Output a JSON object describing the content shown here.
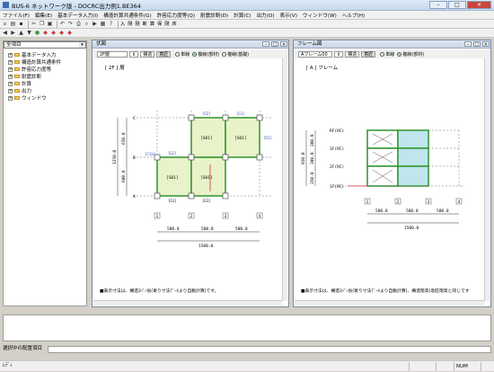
{
  "window": {
    "title": "BUS-6 ネットワーク版 - DOCRC出力例1.BE364",
    "btn_min": "–",
    "btn_max": "□",
    "btn_close": "✕"
  },
  "menu": [
    "ファイル(F)",
    "編集(E)",
    "基本データ入力(I)",
    "構造計算共通条件(G)",
    "許容応力度等(Q)",
    "耐震診断(D)",
    "計算(C)",
    "出力(O)",
    "表示(V)",
    "ウィンドウ(W)",
    "ヘルプ(H)"
  ],
  "toolbar2": [
    "入",
    "剛",
    "剛",
    "断",
    "算",
    "保",
    "剛",
    "床"
  ],
  "tree": {
    "select": "全項目",
    "items": [
      "基本データ入力",
      "構造計算共通条件",
      "許容応力度等",
      "耐震診断",
      "計算",
      "出力",
      "ウィンドウ"
    ]
  },
  "plan": {
    "caption": "伏図",
    "floor": "2F層",
    "tabs": [
      "構造",
      "意匠"
    ],
    "radio1": "単線",
    "radio2": "複線(部材)",
    "radio3": "複線(基礎)",
    "heading": "[ 2F ] 層",
    "note": "■表示寸法は、構造ｽﾊﾟﾝ長(寄り寸法ﾃﾞｰﾀより自動計算)です。",
    "axes_x": [
      "1",
      "2",
      "3",
      "4"
    ],
    "axes_y": [
      "A",
      "B",
      "C"
    ],
    "spans": [
      "500.0",
      "500.0",
      "500.0"
    ],
    "total": "1500.0",
    "yspans": [
      "600.0",
      "650.0"
    ],
    "ytotal": "1250.0",
    "slab": "[S01]",
    "beams": [
      "[G1]",
      "[G2]",
      "[G2]",
      "[G1]",
      "[C1a]",
      "[D1]"
    ]
  },
  "frame": {
    "caption": "フレーム図",
    "frame": "Aフレーム00",
    "tabs": [
      "構造",
      "意匠"
    ],
    "radio1": "単線",
    "radio2": "複線(部材)",
    "heading": "[ A ] フレーム",
    "note": "■表示寸法は、構造ｽﾊﾟﾝ長(寄り寸法ﾃﾞｰﾀより自動計算)、構造階高(意匠階高と同じです",
    "floors": [
      "RF(RC)",
      "3F(RC)",
      "2F(RC)",
      "1F(RC)"
    ],
    "axes_x": [
      "1",
      "2",
      "3",
      "4"
    ],
    "spans": [
      "500.0",
      "500.0",
      "500.0"
    ],
    "total": "1500.0",
    "heights": [
      "300.0",
      "300.0",
      "350.0"
    ],
    "htotal": "950.0"
  },
  "info": {
    "label": "選択中の配置項目"
  },
  "status": {
    "left": "ﾚﾃﾞｨ",
    "num": "NUM"
  },
  "colors": {
    "green": "#3a9a3a",
    "member": "#e9f3c9",
    "cyan": "#bfe6ee"
  }
}
